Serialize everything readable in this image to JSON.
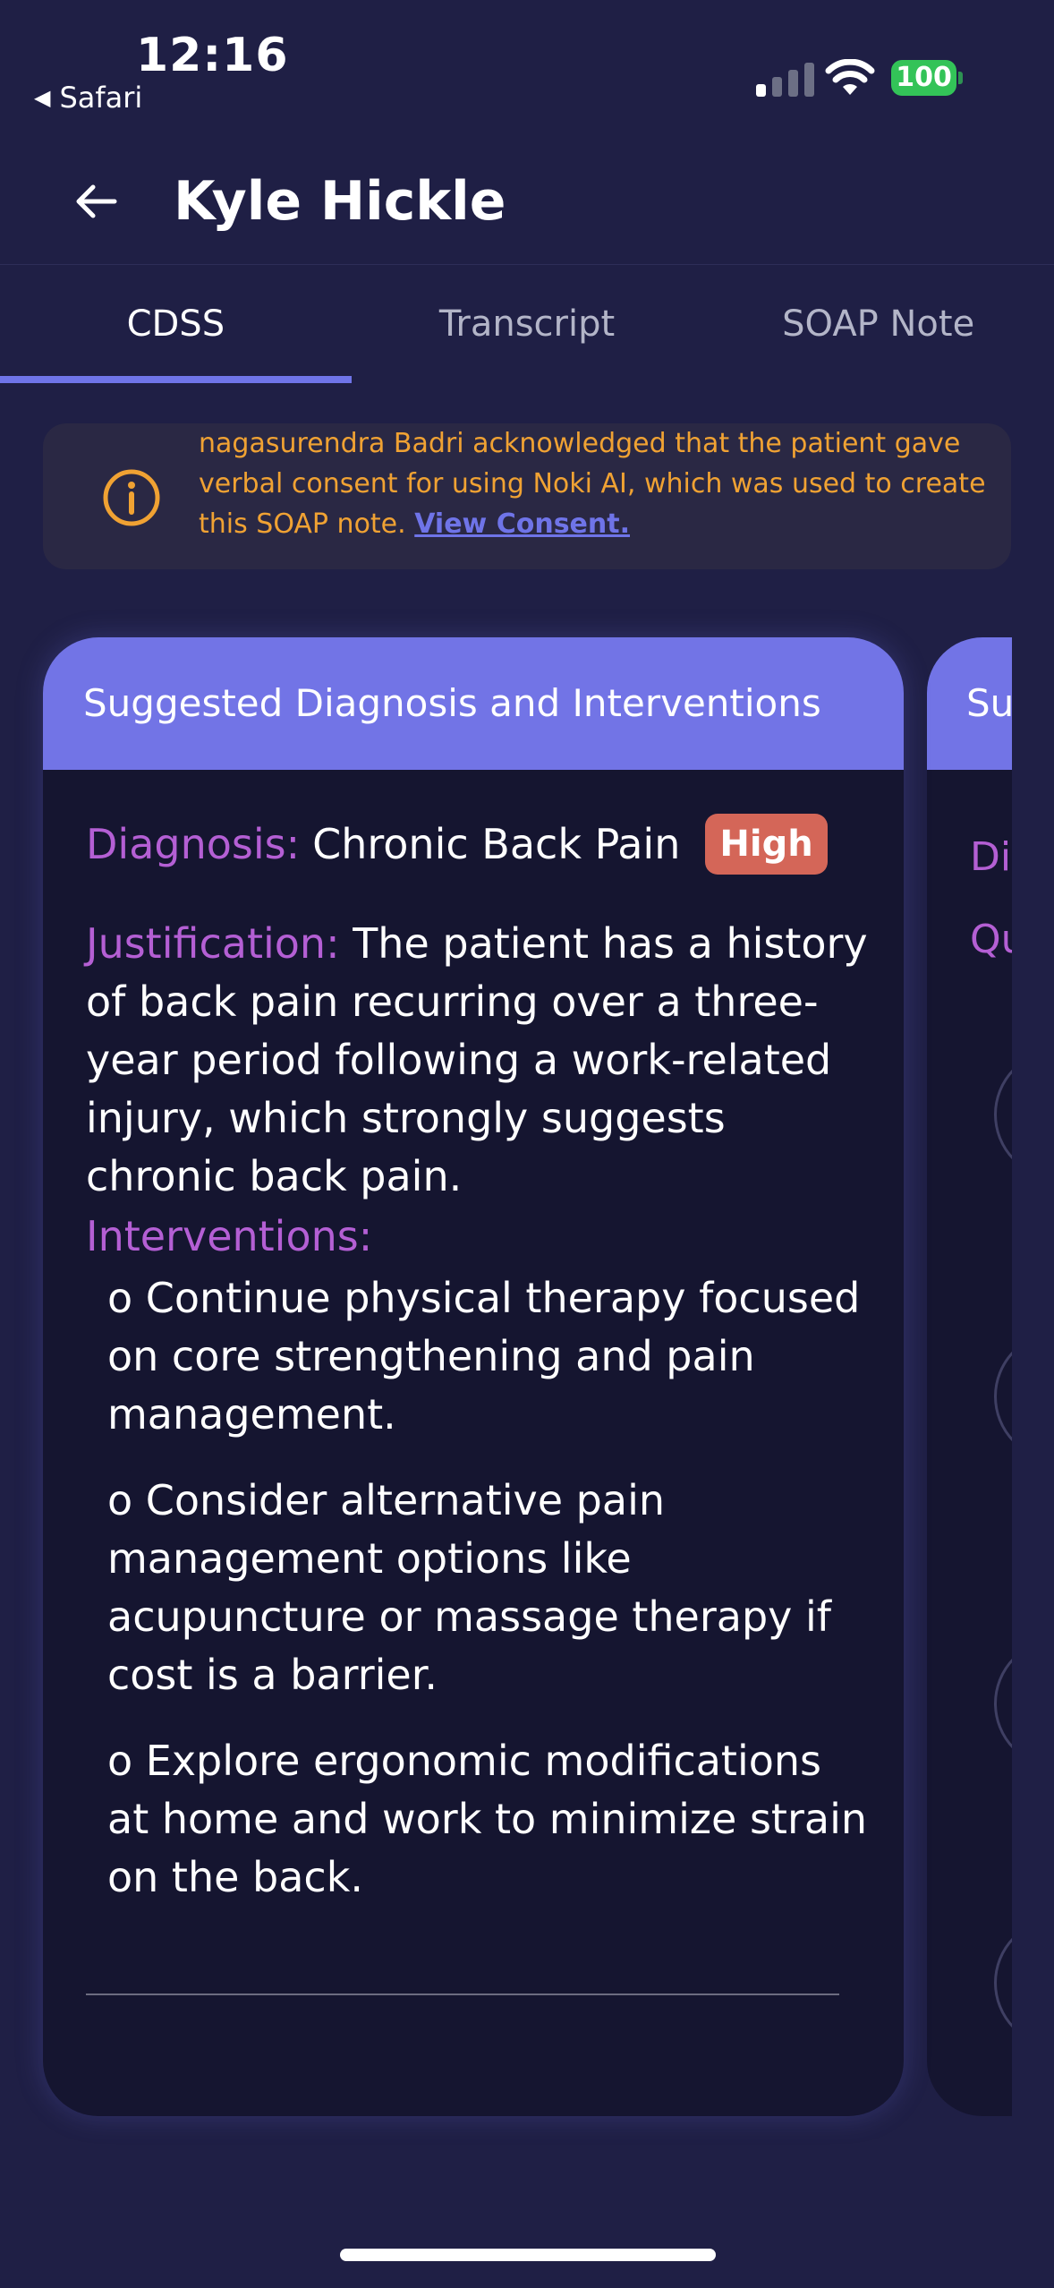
{
  "status_bar": {
    "time": "12:16",
    "back_app": "Safari",
    "battery": "100",
    "battery_color": "#33c358",
    "signal_bars_on": 1,
    "signal_bars_total": 4
  },
  "header": {
    "back_icon": "arrow-left-icon",
    "title": "Kyle Hickle"
  },
  "tabs": [
    {
      "label": "CDSS",
      "active": true
    },
    {
      "label": "Transcript",
      "active": false
    },
    {
      "label": "SOAP Note",
      "active": false
    }
  ],
  "banner": {
    "icon": "info-icon",
    "text": "nagasurendra Badri acknowledged that the patient gave verbal consent for using Noki AI, which was used to create this SOAP note.",
    "link": "View Consent.",
    "text_color": "#f0a233",
    "link_color": "#6f74e8"
  },
  "card": {
    "header": "Suggested Diagnosis and Interventions",
    "diagnosis_label": "Diagnosis:",
    "diagnosis_value": "Chronic Back Pain",
    "severity": "High",
    "severity_color": "#d46658",
    "justification_label": "Justification:",
    "justification_text": "The patient has a history of back pain recurring over a three-year period following a work-related injury, which strongly suggests chronic back pain.",
    "interventions_label": "Interventions:",
    "interventions": [
      "o Continue physical therapy focused on core strengthening and pain management.",
      "o Consider alternative pain management options like acupuncture or massage therapy if cost is a barrier.",
      "o Explore ergonomic modifications at home and work to minimize strain on the back."
    ]
  },
  "next_card": {
    "header": "Su",
    "line1": "Di",
    "line2": "Qu"
  },
  "colors": {
    "background": "#1f1f45",
    "accent": "#6f74e8",
    "card_header": "#7274e6",
    "label": "#b45fd4"
  }
}
